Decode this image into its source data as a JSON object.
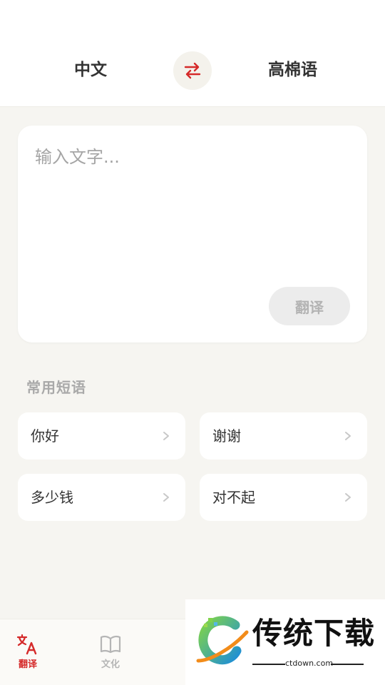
{
  "header": {
    "source_lang": "中文",
    "target_lang": "高棉语",
    "swap_icon": "swap-arrows-icon",
    "accent_color": "#d52a2a"
  },
  "input": {
    "placeholder": "输入文字...",
    "value": "",
    "translate_label": "翻译"
  },
  "phrases": {
    "title": "常用短语",
    "items": [
      {
        "label": "你好"
      },
      {
        "label": "谢谢"
      },
      {
        "label": "多少钱"
      },
      {
        "label": "对不起"
      }
    ]
  },
  "bottom_nav": {
    "items": [
      {
        "label": "翻译",
        "icon": "translate-icon",
        "active": true
      },
      {
        "label": "文化",
        "icon": "book-icon",
        "active": false
      },
      {
        "label": "",
        "icon": "partial-icon",
        "active": false
      }
    ]
  },
  "watermark": {
    "brand": "传统下载",
    "url": "ctdown.com"
  }
}
